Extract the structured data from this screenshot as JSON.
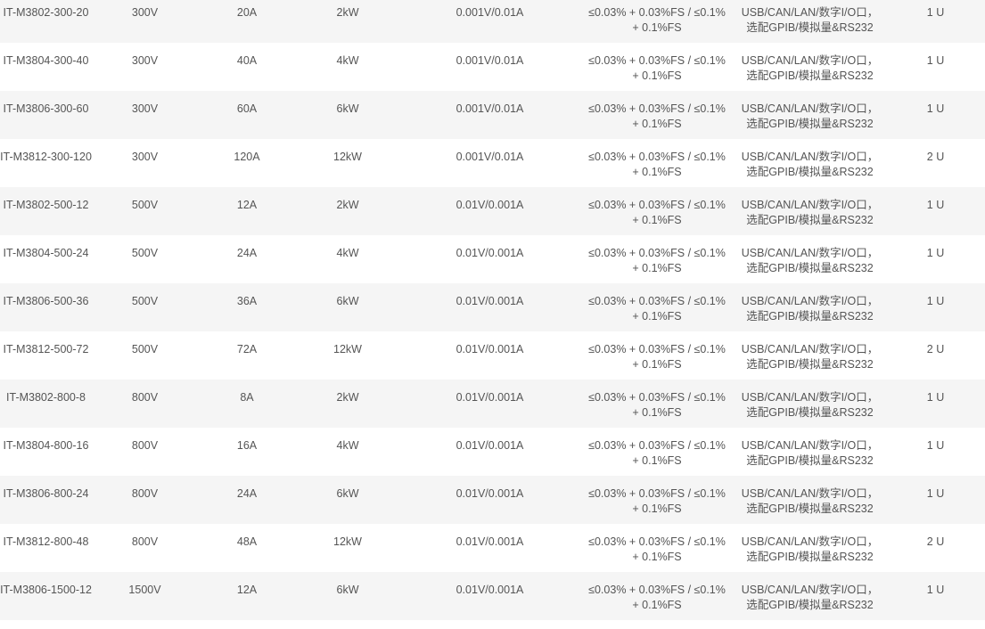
{
  "table": {
    "rows": [
      {
        "model": "IT-M3802-300-20",
        "voltage": "300V",
        "current": "20A",
        "power": "2kW",
        "resolution": "0.001V/0.01A",
        "accuracy": "≤0.03% + 0.03%FS / ≤0.1% + 0.1%FS",
        "interface": "USB/CAN/LAN/数字I/O口，选配GPIB/模拟量&RS232",
        "size": "1 U"
      },
      {
        "model": "IT-M3804-300-40",
        "voltage": "300V",
        "current": "40A",
        "power": "4kW",
        "resolution": "0.001V/0.01A",
        "accuracy": "≤0.03% + 0.03%FS / ≤0.1% + 0.1%FS",
        "interface": "USB/CAN/LAN/数字I/O口，选配GPIB/模拟量&RS232",
        "size": "1 U"
      },
      {
        "model": "IT-M3806-300-60",
        "voltage": "300V",
        "current": "60A",
        "power": "6kW",
        "resolution": "0.001V/0.01A",
        "accuracy": "≤0.03% + 0.03%FS / ≤0.1% + 0.1%FS",
        "interface": "USB/CAN/LAN/数字I/O口，选配GPIB/模拟量&RS232",
        "size": "1 U"
      },
      {
        "model": "IT-M3812-300-120",
        "voltage": "300V",
        "current": "120A",
        "power": "12kW",
        "resolution": "0.001V/0.01A",
        "accuracy": "≤0.03% + 0.03%FS / ≤0.1% + 0.1%FS",
        "interface": "USB/CAN/LAN/数字I/O口，选配GPIB/模拟量&RS232",
        "size": "2 U"
      },
      {
        "model": "IT-M3802-500-12",
        "voltage": "500V",
        "current": "12A",
        "power": "2kW",
        "resolution": "0.01V/0.001A",
        "accuracy": "≤0.03% + 0.03%FS / ≤0.1% + 0.1%FS",
        "interface": "USB/CAN/LAN/数字I/O口，选配GPIB/模拟量&RS232",
        "size": "1 U"
      },
      {
        "model": "IT-M3804-500-24",
        "voltage": "500V",
        "current": "24A",
        "power": "4kW",
        "resolution": "0.01V/0.001A",
        "accuracy": "≤0.03% + 0.03%FS / ≤0.1% + 0.1%FS",
        "interface": "USB/CAN/LAN/数字I/O口，选配GPIB/模拟量&RS232",
        "size": "1 U"
      },
      {
        "model": "IT-M3806-500-36",
        "voltage": "500V",
        "current": "36A",
        "power": "6kW",
        "resolution": "0.01V/0.001A",
        "accuracy": "≤0.03% + 0.03%FS / ≤0.1% + 0.1%FS",
        "interface": "USB/CAN/LAN/数字I/O口，选配GPIB/模拟量&RS232",
        "size": "1 U"
      },
      {
        "model": "IT-M3812-500-72",
        "voltage": "500V",
        "current": "72A",
        "power": "12kW",
        "resolution": "0.01V/0.001A",
        "accuracy": "≤0.03% + 0.03%FS / ≤0.1% + 0.1%FS",
        "interface": "USB/CAN/LAN/数字I/O口，选配GPIB/模拟量&RS232",
        "size": "2 U"
      },
      {
        "model": "IT-M3802-800-8",
        "voltage": "800V",
        "current": "8A",
        "power": "2kW",
        "resolution": "0.01V/0.001A",
        "accuracy": "≤0.03% + 0.03%FS / ≤0.1% + 0.1%FS",
        "interface": "USB/CAN/LAN/数字I/O口，选配GPIB/模拟量&RS232",
        "size": "1 U"
      },
      {
        "model": "IT-M3804-800-16",
        "voltage": "800V",
        "current": "16A",
        "power": "4kW",
        "resolution": "0.01V/0.001A",
        "accuracy": "≤0.03% + 0.03%FS / ≤0.1% + 0.1%FS",
        "interface": "USB/CAN/LAN/数字I/O口，选配GPIB/模拟量&RS232",
        "size": "1 U"
      },
      {
        "model": "IT-M3806-800-24",
        "voltage": "800V",
        "current": "24A",
        "power": "6kW",
        "resolution": "0.01V/0.001A",
        "accuracy": "≤0.03% + 0.03%FS / ≤0.1% + 0.1%FS",
        "interface": "USB/CAN/LAN/数字I/O口，选配GPIB/模拟量&RS232",
        "size": "1 U"
      },
      {
        "model": "IT-M3812-800-48",
        "voltage": "800V",
        "current": "48A",
        "power": "12kW",
        "resolution": "0.01V/0.001A",
        "accuracy": "≤0.03% + 0.03%FS / ≤0.1% + 0.1%FS",
        "interface": "USB/CAN/LAN/数字I/O口，选配GPIB/模拟量&RS232",
        "size": "2 U"
      },
      {
        "model": "IT-M3806-1500-12",
        "voltage": "1500V",
        "current": "12A",
        "power": "6kW",
        "resolution": "0.01V/0.001A",
        "accuracy": "≤0.03% + 0.03%FS / ≤0.1% + 0.1%FS",
        "interface": "USB/CAN/LAN/数字I/O口，选配GPIB/模拟量&RS232",
        "size": "1 U"
      }
    ]
  }
}
